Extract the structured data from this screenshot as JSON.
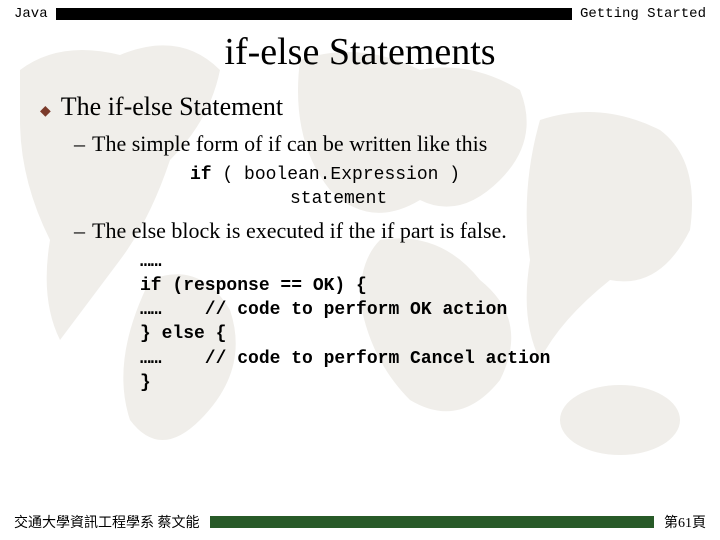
{
  "header": {
    "left": "Java",
    "right": "Getting Started"
  },
  "title": "if-else Statements",
  "bullets": {
    "lvl1": "The if-else Statement",
    "sub1": "The simple form of if can be written like this",
    "sub2": "The else block is executed if the if part is false."
  },
  "code1": {
    "line1_kw": "if",
    "line1_rest": "  ( boolean.Expression )",
    "line2": "statement"
  },
  "code2": "……\nif (response == OK) {\n……    // code to perform OK action\n} else {\n……    // code to perform Cancel action\n}",
  "footer": {
    "left": "交通大學資訊工程學系 蔡文能",
    "right": "第61頁"
  }
}
